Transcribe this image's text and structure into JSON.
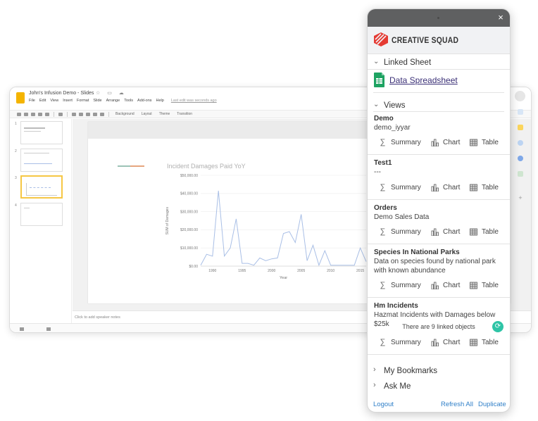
{
  "slides": {
    "title": "John's Infusion Demo - Slides",
    "menu": [
      "File",
      "Edit",
      "View",
      "Insert",
      "Format",
      "Slide",
      "Arrange",
      "Tools",
      "Add-ons",
      "Help"
    ],
    "last_edit": "Last edit was seconds ago",
    "toolbar": [
      "Background",
      "Layout",
      "Theme",
      "Transition"
    ],
    "thumbs": [
      "1",
      "2",
      "3",
      "4"
    ],
    "notes_placeholder": "Click to add speaker notes"
  },
  "chart_data": {
    "type": "line",
    "title": "Incident Damages Paid YoY",
    "xlabel": "Year",
    "ylabel": "SUM of Damages",
    "xlim": [
      1988,
      2016
    ],
    "ylim": [
      0,
      50000
    ],
    "x_ticks": [
      "1990",
      "1995",
      "2000",
      "2005",
      "2010",
      "2015"
    ],
    "y_ticks": [
      "$0.00",
      "$10,000.00",
      "$20,000.00",
      "$30,000.00",
      "$40,000.00",
      "$50,000.00"
    ],
    "series": [
      {
        "x": [
          1988,
          1989,
          1990,
          1991,
          1992,
          1993,
          1994,
          1995,
          1996,
          1997,
          1998,
          1999,
          2000,
          2001,
          2002,
          2003,
          2004,
          2005,
          2006,
          2007,
          2008,
          2009,
          2010,
          2011,
          2012,
          2013,
          2014,
          2015,
          2016
        ],
        "y": [
          500,
          6500,
          5500,
          41500,
          5500,
          10000,
          26000,
          1500,
          1500,
          500,
          4500,
          3000,
          4000,
          4500,
          18000,
          19000,
          13000,
          28500,
          3000,
          11500,
          500,
          8500,
          500,
          500,
          500,
          500,
          500,
          10000,
          2500
        ],
        "color": "#a9bfe6"
      }
    ],
    "grid": true,
    "legend": "none"
  },
  "panel": {
    "brand": "CREATIVE SQUAD",
    "close_symbol": "×",
    "linked_sheet_heading": "Linked Sheet",
    "spreadsheet_link": "Data Spreadsheet",
    "views_heading": "Views",
    "actions": {
      "summary": "Summary",
      "chart": "Chart",
      "table": "Table"
    },
    "views": [
      {
        "name": "Demo",
        "desc": "demo_iyyar"
      },
      {
        "name": "Test1",
        "desc": "---"
      },
      {
        "name": "Orders",
        "desc": "Demo Sales Data"
      },
      {
        "name": "Species In National Parks",
        "desc": "Data on species found by national park with known abundance"
      },
      {
        "name": "Hm Incidents",
        "desc": "Hazmat Incidents with Damages below $25k",
        "linked_objects": "There are 9 linked objects"
      }
    ],
    "bookmarks_heading": "My Bookmarks",
    "ask_heading": "Ask Me",
    "footer": {
      "logout": "Logout",
      "refresh_all": "Refresh All",
      "duplicate": "Duplicate"
    },
    "accent_color": "#2ec4a6",
    "link_color": "#2f7fc8"
  }
}
